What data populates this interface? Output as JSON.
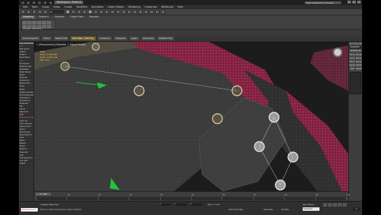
{
  "titlebar": {
    "file_tab": "Workspace: Default",
    "search_placeholder": "Type a keyword or phrase"
  },
  "menu": [
    "Edit",
    "Tools",
    "Group",
    "Views",
    "Create",
    "Modifiers",
    "Animation",
    "Graph Editors",
    "Rendering",
    "Customize",
    "MAXScript",
    "Help"
  ],
  "toolbar": {
    "selection_filter": "All"
  },
  "ribbon": {
    "tabs": [
      "Modeling",
      "Freeform",
      "Selection",
      "Object Paint",
      "Populate"
    ],
    "panel_label": "Polygon Modeling"
  },
  "subbar": [
    "Scene Explorer",
    "Select",
    "Modify Edit",
    "Edit Mesh / Edit Poly",
    "Customize",
    "Viewports",
    "Layers",
    "Selections",
    "Editable Poly"
  ],
  "left_panel": {
    "heading": "Scene Explorer",
    "items": [
      "Ctrl",
      "Edit Geom",
      "Attach",
      "Detach",
      "Slice Plane",
      "Cut",
      "Quickslice",
      "Meshsmooth",
      "Tessellate",
      "Make Planar",
      "Relax",
      "Hide Sel",
      "Unhide All",
      "Named Sel",
      "Copy",
      "Paste",
      "Delete Isolated",
      "Full Interactivity",
      "Subdivision",
      "Smoothing",
      "Materials",
      "IDs",
      "Set ID",
      "Select ID",
      "Sort",
      "Smooth Groups",
      "Clear All",
      "Auto Smooth",
      "Vertex Color",
      "Alpha",
      "Illumination",
      "Paint Deform",
      "Push",
      "Relax",
      "Revert",
      "Brush",
      "Options",
      "Strength",
      "Size",
      "Soft Selection",
      "Use Soft",
      "Falloff"
    ],
    "highlighted_items": [
      "Ctrl",
      "Cut",
      "Smooth Groups"
    ]
  },
  "viewport": {
    "label": "+ [Perspective] [Realistic + Edged Faces]",
    "stats": [
      "Total",
      "Polys: 1,248,300",
      "Verts: 1,252,110",
      "FPS: 24.5"
    ]
  },
  "right_panel": {
    "object_name": "Object001",
    "modifier_list": "Modifier List",
    "buttons": [
      "FFD 4x4x4",
      "FFD Select",
      "Turn to Poly",
      "Extrude Face",
      "Mesh Select",
      "Poly Select",
      "Symmetry",
      "UVW Map",
      "Shell",
      "TurboSmooth"
    ]
  },
  "timeline": {
    "slider_label": "0 / 100",
    "tick_labels": [
      "0",
      "10",
      "20",
      "30",
      "40",
      "50",
      "60",
      "70",
      "80",
      "90",
      "100"
    ]
  },
  "statusbar": {
    "maxscript": "Welcome to M",
    "selected": "1 Object Selected",
    "prompt": "Click or click-and-drag to select objects",
    "x": "X:",
    "y": "Y:",
    "z": "Z:",
    "grid": "Grid = 10.0",
    "add_time_tag": "Add Time Tag",
    "auto_key": "Auto Key",
    "mode": "Selected",
    "set_key": "Set Key",
    "key_filters": "Key Filters...",
    "frame": "0"
  }
}
